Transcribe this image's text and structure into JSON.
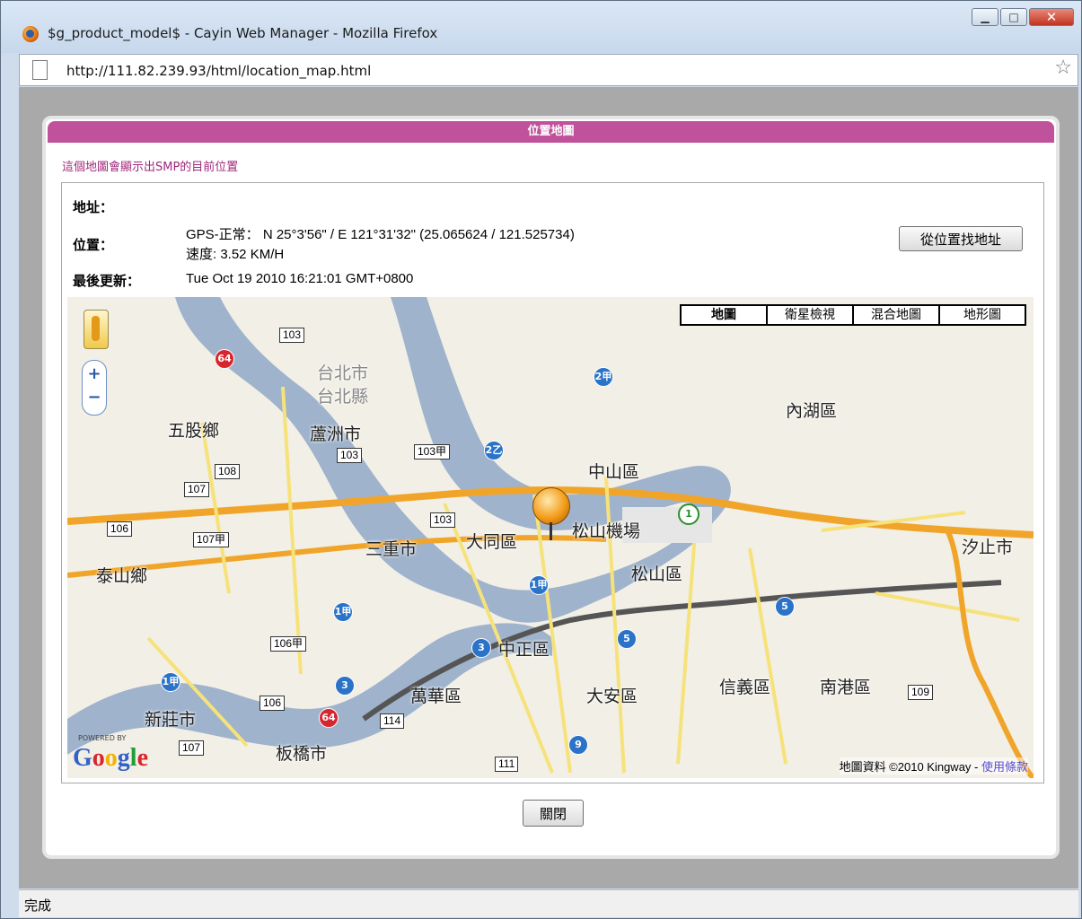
{
  "window": {
    "title": "$g_product_model$ - Cayin Web Manager - Mozilla Firefox",
    "url": "http://111.82.239.93/html/location_map.html",
    "status": "完成",
    "controls": [
      "minimize",
      "maximize",
      "close"
    ]
  },
  "dialog": {
    "header": "位置地圖",
    "subtitle": "這個地圖會顯示出SMP的目前位置",
    "address_label": "地址：",
    "address_value": "",
    "location_label": "位置：",
    "location_value": "GPS-正常：  N 25°3'56\" / E 121°31'32\"  (25.065624 / 121.525734)",
    "speed_value": "速度:  3.52 KM/H",
    "updated_label": "最後更新：",
    "updated_value": "Tue Oct 19 2010 16:21:01 GMT+0800",
    "find_address_button": "從位置找地址",
    "close_button": "關閉"
  },
  "map": {
    "types": [
      "地圖",
      "衛星檢視",
      "混合地圖",
      "地形圖"
    ],
    "selected_type": "地圖",
    "zoom_in": "+",
    "zoom_out": "−",
    "powered_by": "POWERED BY",
    "logo": "Google",
    "attribution": "地圖資料 ©2010 Kingway - ",
    "terms_link": "使用條款",
    "area_labels": [
      "五股鄉",
      "蘆洲市",
      "台北市",
      "台北縣",
      "中山區",
      "內湖區",
      "三重市",
      "大同區",
      "松山機場",
      "松山區",
      "汐止市",
      "泰山鄉",
      "中正區",
      "萬華區",
      "大安區",
      "信義區",
      "南港區",
      "新莊市",
      "板橋市"
    ],
    "road_labels": [
      "103",
      "108",
      "107",
      "106",
      "107甲",
      "103甲",
      "106甲",
      "114",
      "111",
      "109",
      "64",
      "2甲",
      "2乙",
      "1甲",
      "3",
      "5",
      "9",
      "1"
    ]
  }
}
